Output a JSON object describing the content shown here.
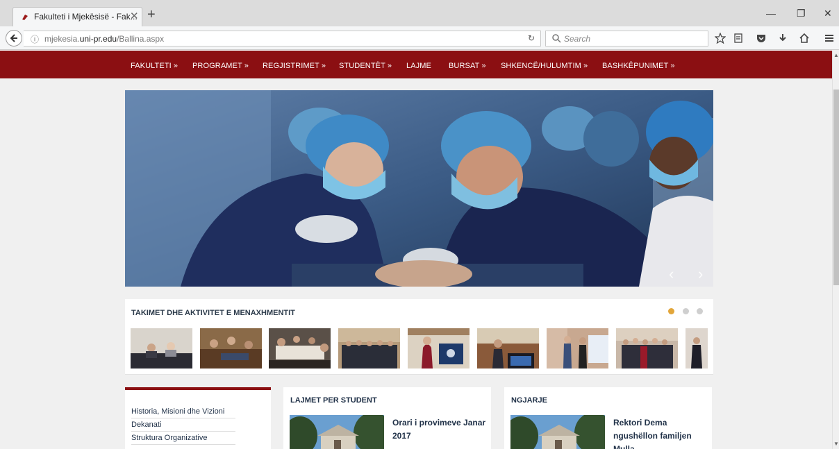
{
  "browser": {
    "tab_title": "Fakulteti i Mjekësisë - Fak...",
    "url_prefix": "mjekesia.",
    "url_domain": "uni-pr.edu",
    "url_path": "/Ballina.aspx",
    "search_placeholder": "Search"
  },
  "main_nav": {
    "items": [
      "FAKULTETI »",
      "PROGRAMET »",
      "REGJISTRIMET »",
      "STUDENTËT »",
      "LAJME",
      "BURSAT »",
      "SHKENCË/HULUMTIM »",
      "BASHKËPUNIMET »"
    ]
  },
  "gallery": {
    "title": "TAKIMET DHE AKTIVITET E MENAXHMENTIT",
    "active_slide": 1,
    "slide_count": 3
  },
  "left_links": [
    "Historia, Misioni dhe Vizioni",
    "Dekanati",
    "Struktura Organizative"
  ],
  "cards": [
    {
      "title": "LAJMET PER STUDENT",
      "headline": "Orari i provimeve Janar 2017"
    },
    {
      "title": "NGJARJE",
      "headline": "Rektori Dema ngushëllon familjen Mulla"
    }
  ],
  "colors": {
    "brand": "#8b0f12",
    "dot_active": "#e2a63a",
    "dot_inactive": "#cfcfcf"
  }
}
